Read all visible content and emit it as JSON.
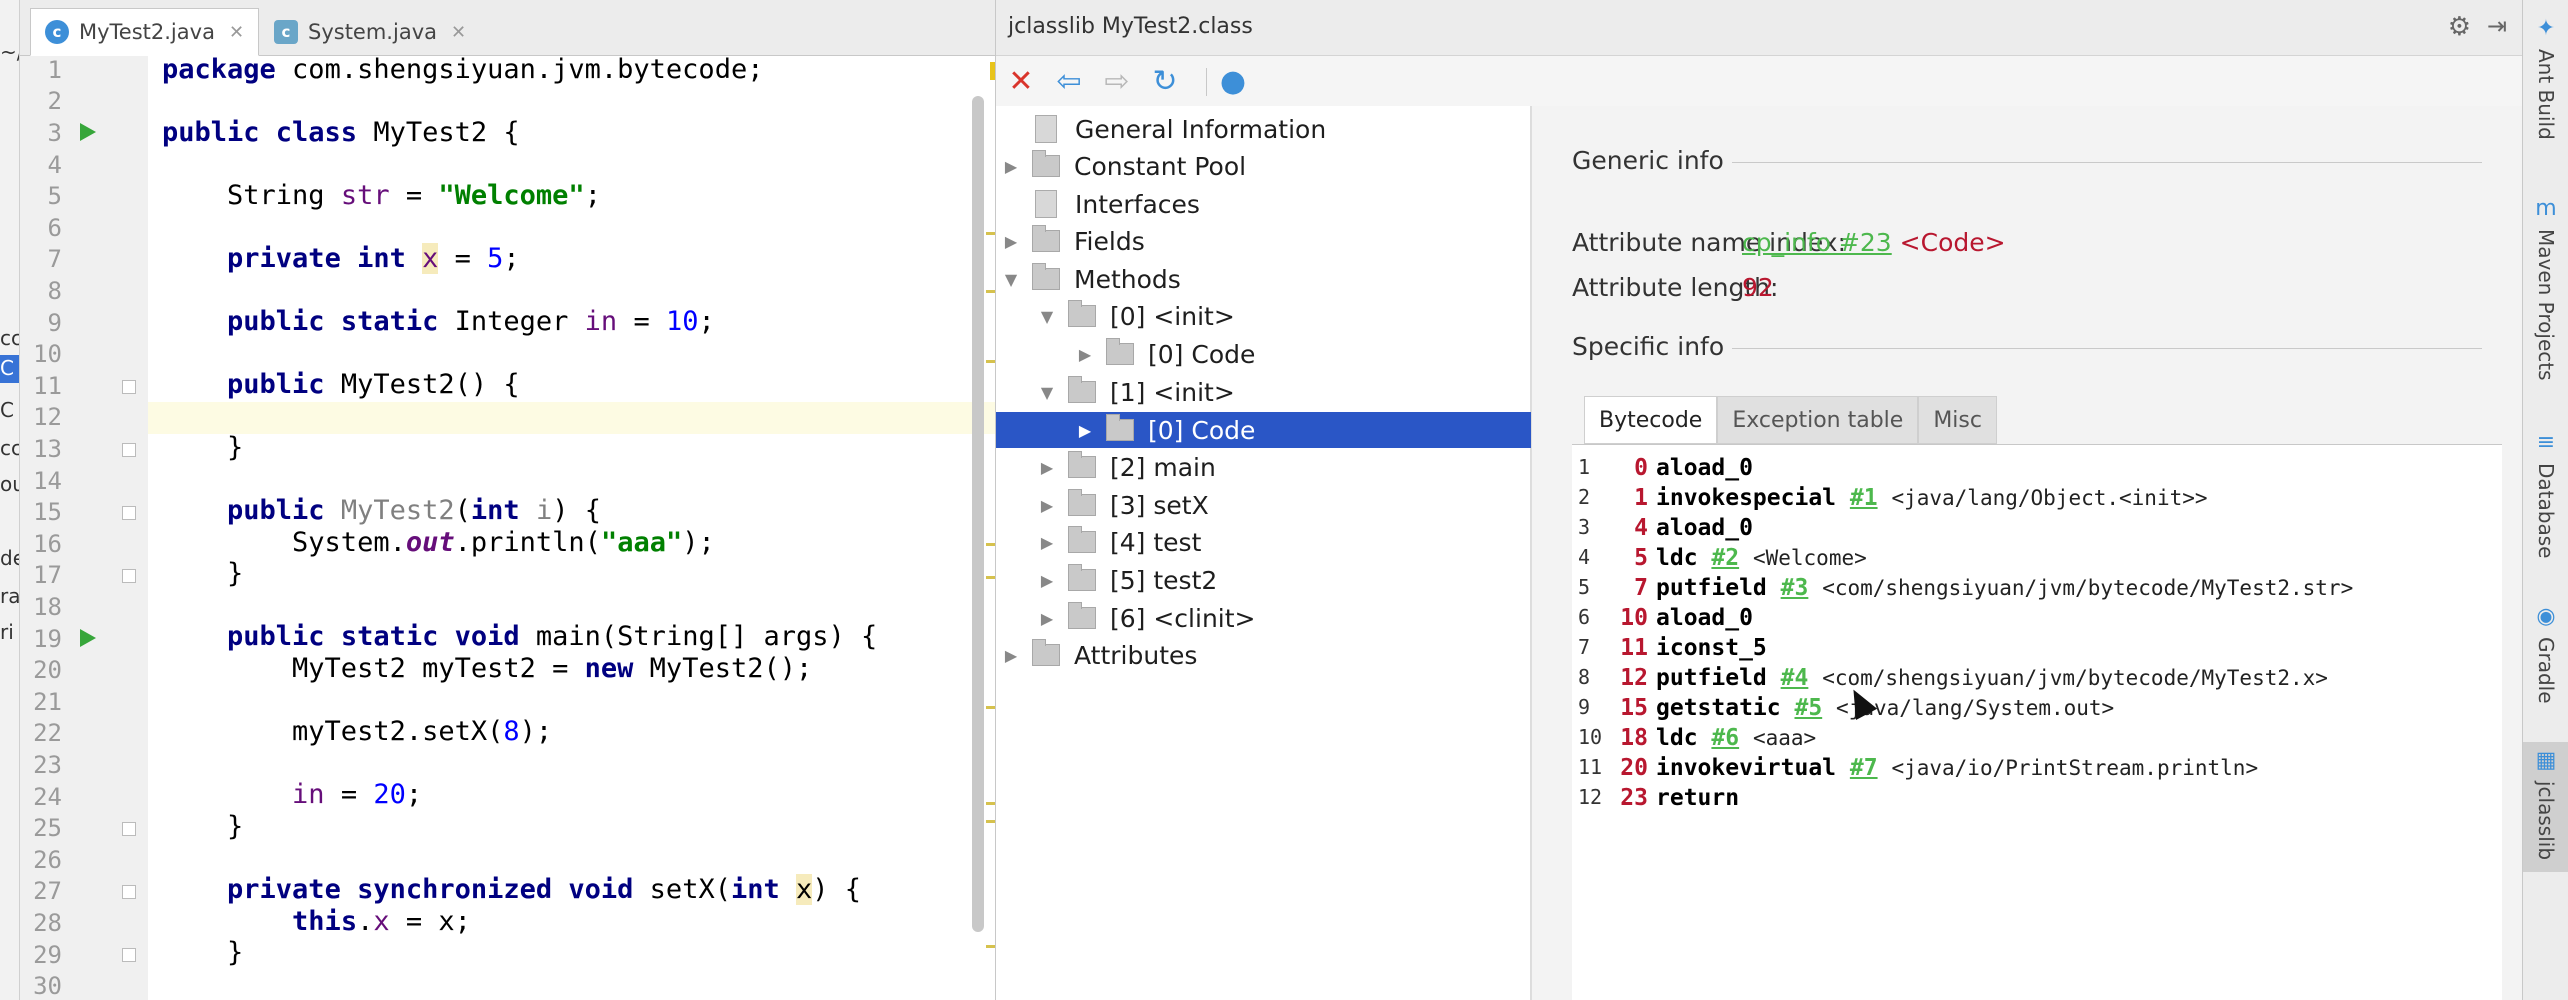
{
  "project_strip": {
    "fragments": [
      {
        "text": "~/"
      },
      {
        "text": "cc"
      },
      {
        "text": "C"
      },
      {
        "text": "C"
      },
      {
        "text": "cc"
      },
      {
        "text": "ou"
      },
      {
        "text": "de"
      },
      {
        "text": "ra"
      },
      {
        "text": "ri"
      }
    ]
  },
  "editor": {
    "tabs": [
      {
        "label": "MyTest2.java",
        "icon": "class-icon"
      },
      {
        "label": "System.java",
        "icon": "class-file-icon"
      }
    ],
    "line_numbers": [
      "1",
      "2",
      "3",
      "4",
      "5",
      "6",
      "7",
      "8",
      "9",
      "10",
      "11",
      "12",
      "13",
      "14",
      "15",
      "16",
      "17",
      "18",
      "19",
      "20",
      "21",
      "22",
      "23",
      "24",
      "25",
      "26",
      "27",
      "28",
      "29",
      "30"
    ]
  },
  "jclasslib": {
    "title": "jclasslib MyTest2.class",
    "toolbar": {
      "close_icon": "close-icon",
      "back_icon": "back-icon",
      "forward_icon": "forward-icon",
      "refresh_icon": "refresh-icon",
      "browser_icon": "web-icon"
    },
    "tree": [
      {
        "label": "General Information",
        "depth": 0,
        "arrow": "",
        "kind": "doc"
      },
      {
        "label": "Constant Pool",
        "depth": 0,
        "arrow": "▶",
        "kind": "folder"
      },
      {
        "label": "Interfaces",
        "depth": 0,
        "arrow": "",
        "kind": "doc"
      },
      {
        "label": "Fields",
        "depth": 0,
        "arrow": "▶",
        "kind": "folder"
      },
      {
        "label": "Methods",
        "depth": 0,
        "arrow": "▼",
        "kind": "folder"
      },
      {
        "label": "[0] <init>",
        "depth": 1,
        "arrow": "▼",
        "kind": "folder"
      },
      {
        "label": "[0] Code",
        "depth": 2,
        "arrow": "▶",
        "kind": "folder"
      },
      {
        "label": "[1] <init>",
        "depth": 1,
        "arrow": "▼",
        "kind": "folder"
      },
      {
        "label": "[0] Code",
        "depth": 2,
        "arrow": "▶",
        "kind": "folder",
        "selected": true
      },
      {
        "label": "[2] main",
        "depth": 1,
        "arrow": "▶",
        "kind": "folder"
      },
      {
        "label": "[3] setX",
        "depth": 1,
        "arrow": "▶",
        "kind": "folder"
      },
      {
        "label": "[4] test",
        "depth": 1,
        "arrow": "▶",
        "kind": "folder"
      },
      {
        "label": "[5] test2",
        "depth": 1,
        "arrow": "▶",
        "kind": "folder"
      },
      {
        "label": "[6] <clinit>",
        "depth": 1,
        "arrow": "▶",
        "kind": "folder"
      },
      {
        "label": "Attributes",
        "depth": 0,
        "arrow": "▶",
        "kind": "folder"
      }
    ],
    "generic_info": {
      "title": "Generic info",
      "name_index_label": "Attribute name index:",
      "name_index_link": "cp_info #23",
      "name_index_value": "<Code>",
      "length_label": "Attribute length:",
      "length_value": "92"
    },
    "specific_info": {
      "title": "Specific info",
      "tabs": [
        "Bytecode",
        "Exception table",
        "Misc"
      ],
      "bytecode": [
        {
          "line": "1",
          "offset": "0",
          "op": "aload_0",
          "ref": "",
          "comment": ""
        },
        {
          "line": "2",
          "offset": "1",
          "op": "invokespecial",
          "ref": "#1",
          "comment": "<java/lang/Object.<init>>"
        },
        {
          "line": "3",
          "offset": "4",
          "op": "aload_0",
          "ref": "",
          "comment": ""
        },
        {
          "line": "4",
          "offset": "5",
          "op": "ldc",
          "ref": "#2",
          "comment": "<Welcome>"
        },
        {
          "line": "5",
          "offset": "7",
          "op": "putfield",
          "ref": "#3",
          "comment": "<com/shengsiyuan/jvm/bytecode/MyTest2.str>"
        },
        {
          "line": "6",
          "offset": "10",
          "op": "aload_0",
          "ref": "",
          "comment": ""
        },
        {
          "line": "7",
          "offset": "11",
          "op": "iconst_5",
          "ref": "",
          "comment": ""
        },
        {
          "line": "8",
          "offset": "12",
          "op": "putfield",
          "ref": "#4",
          "comment": "<com/shengsiyuan/jvm/bytecode/MyTest2.x>"
        },
        {
          "line": "9",
          "offset": "15",
          "op": "getstatic",
          "ref": "#5",
          "comment": "<java/lang/System.out>"
        },
        {
          "line": "10",
          "offset": "18",
          "op": "ldc",
          "ref": "#6",
          "comment": "<aaa>"
        },
        {
          "line": "11",
          "offset": "20",
          "op": "invokevirtual",
          "ref": "#7",
          "comment": "<java/io/PrintStream.println>"
        },
        {
          "line": "12",
          "offset": "23",
          "op": "return",
          "ref": "",
          "comment": ""
        }
      ]
    }
  },
  "right_tools": [
    {
      "label": "Ant Build",
      "icon": "ant-icon"
    },
    {
      "label": "Maven Projects",
      "icon": "maven-icon"
    },
    {
      "label": "Database",
      "icon": "database-icon"
    },
    {
      "label": "Gradle",
      "icon": "gradle-icon"
    },
    {
      "label": "jclasslib",
      "icon": "jclasslib-icon"
    }
  ],
  "colors": {
    "keyword": "#000080",
    "string": "#008000",
    "number": "#0000ff",
    "field": "#660e7a",
    "selection": "#2a56c6",
    "link": "#4db84d",
    "bytecode_offset": "#b8172f"
  }
}
